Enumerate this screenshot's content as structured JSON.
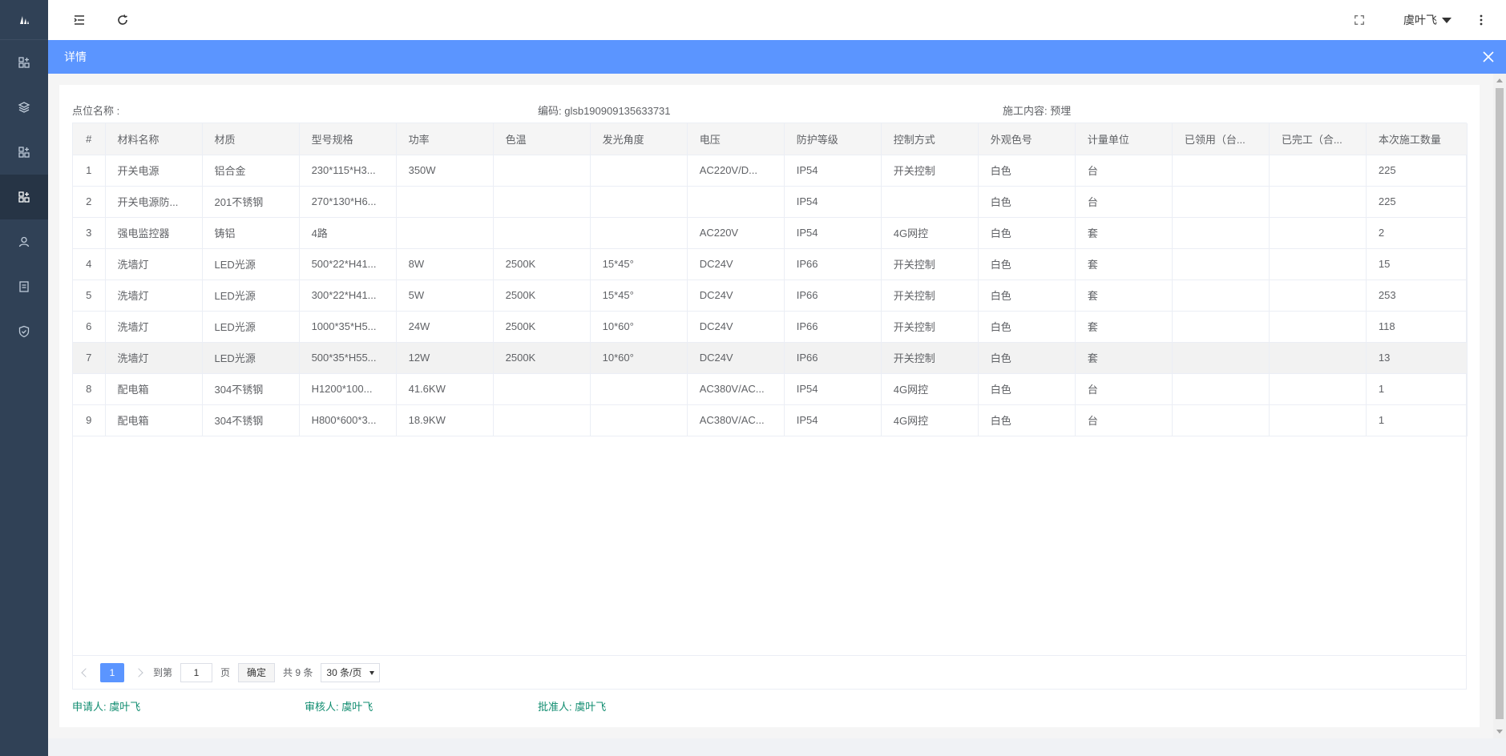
{
  "sidebar": {
    "logo_icon": "logo-icon",
    "items": [
      {
        "icon": "dashboard-icon",
        "active": false
      },
      {
        "icon": "layers-icon",
        "active": false
      },
      {
        "icon": "grid-add-icon",
        "active": false
      },
      {
        "icon": "grid-add-icon",
        "active": true
      },
      {
        "icon": "user-icon",
        "active": false
      },
      {
        "icon": "document-icon",
        "active": false
      },
      {
        "icon": "shield-icon",
        "active": false
      }
    ]
  },
  "topbar": {
    "menu_icon": "hamburger-icon",
    "refresh_icon": "refresh-icon",
    "fullscreen_icon": "fullscreen-icon",
    "user_name": "虞叶飞",
    "more_icon": "more-vertical-icon"
  },
  "modal": {
    "title": "详情",
    "info": {
      "point_name": "点位名称 :",
      "code": "编码: glsb190909135633731",
      "content": "施工内容: 预埋"
    },
    "table": {
      "headers": [
        "#",
        "材料名称",
        "材质",
        "型号规格",
        "功率",
        "色温",
        "发光角度",
        "电压",
        "防护等级",
        "控制方式",
        "外观色号",
        "计量单位",
        "已领用（台...",
        "已完工（合...",
        "本次施工数量"
      ],
      "rows": [
        [
          "1",
          "开关电源",
          "铝合金",
          "230*115*H3...",
          "350W",
          "",
          "",
          "AC220V/D...",
          "IP54",
          "开关控制",
          "白色",
          "台",
          "",
          "",
          "225"
        ],
        [
          "2",
          "开关电源防...",
          "201不锈钢",
          "270*130*H6...",
          "",
          "",
          "",
          "",
          "IP54",
          "",
          "白色",
          "台",
          "",
          "",
          "225"
        ],
        [
          "3",
          "强电监控器",
          "铸铝",
          "4路",
          "",
          "",
          "",
          "AC220V",
          "IP54",
          "4G网控",
          "白色",
          "套",
          "",
          "",
          "2"
        ],
        [
          "4",
          "洗墙灯",
          "LED光源",
          "500*22*H41...",
          "8W",
          "2500K",
          "15*45°",
          "DC24V",
          "IP66",
          "开关控制",
          "白色",
          "套",
          "",
          "",
          "15"
        ],
        [
          "5",
          "洗墙灯",
          "LED光源",
          "300*22*H41...",
          "5W",
          "2500K",
          "15*45°",
          "DC24V",
          "IP66",
          "开关控制",
          "白色",
          "套",
          "",
          "",
          "253"
        ],
        [
          "6",
          "洗墙灯",
          "LED光源",
          "1000*35*H5...",
          "24W",
          "2500K",
          "10*60°",
          "DC24V",
          "IP66",
          "开关控制",
          "白色",
          "套",
          "",
          "",
          "118"
        ],
        [
          "7",
          "洗墙灯",
          "LED光源",
          "500*35*H55...",
          "12W",
          "2500K",
          "10*60°",
          "DC24V",
          "IP66",
          "开关控制",
          "白色",
          "套",
          "",
          "",
          "13"
        ],
        [
          "8",
          "配电箱",
          "304不锈钢",
          "H1200*100...",
          "41.6KW",
          "",
          "",
          "AC380V/AC...",
          "IP54",
          "4G网控",
          "白色",
          "台",
          "",
          "",
          "1"
        ],
        [
          "9",
          "配电箱",
          "304不锈钢",
          "H800*600*3...",
          "18.9KW",
          "",
          "",
          "AC380V/AC...",
          "IP54",
          "4G网控",
          "白色",
          "台",
          "",
          "",
          "1"
        ]
      ],
      "highlighted_row": 6
    },
    "pager": {
      "current_page": "1",
      "goto_label": "到第",
      "goto_value": "1",
      "page_label": "页",
      "confirm_label": "确定",
      "total_label": "共 9 条",
      "page_size": "30 条/页"
    },
    "signatures": {
      "applicant": "申请人: 虞叶飞",
      "reviewer": "审核人: 虞叶飞",
      "approver": "批准人: 虞叶飞"
    }
  },
  "colors": {
    "sidebar_bg": "#304156",
    "header_blue": "#5b95ff",
    "signature_green": "#0f8c6f"
  }
}
